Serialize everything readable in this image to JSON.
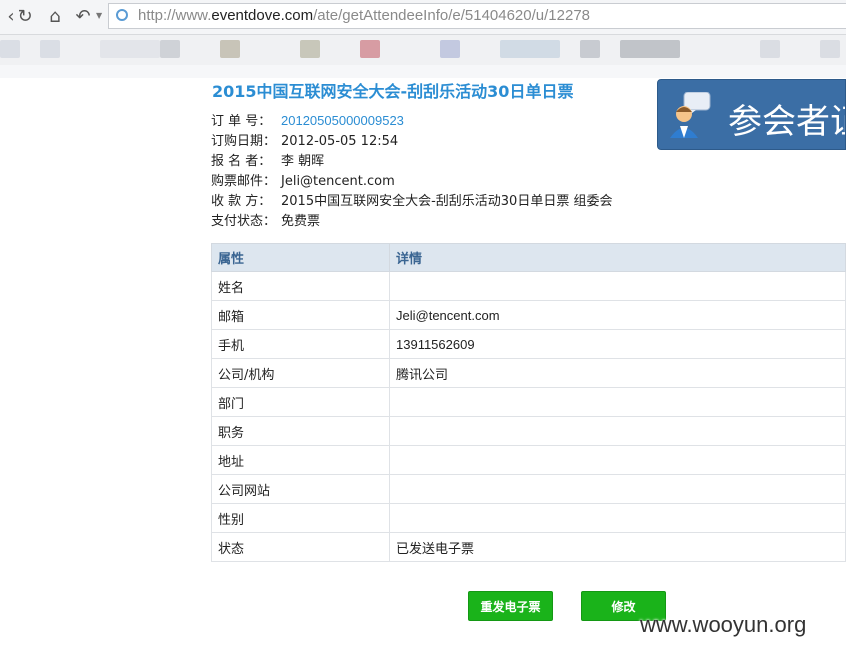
{
  "browser": {
    "url_prefix": "http://www.",
    "url_domain": "eventdove.com",
    "url_path": "/ate/getAttendeeInfo/e/51404620/u/12278"
  },
  "event": {
    "title": "2015中国互联网安全大会-刮刮乐活动30日单日票"
  },
  "banner": {
    "text": "参会者证"
  },
  "order": {
    "fields": [
      {
        "label": "订  单  号：",
        "value": "20120505000009523"
      },
      {
        "label": "订购日期：",
        "value": "2012-05-05 12:54"
      },
      {
        "label": "报  名  者：",
        "value": "李 朝晖"
      },
      {
        "label": "购票邮件：",
        "value": "Jeli@tencent.com"
      },
      {
        "label": "收  款  方：",
        "value": "2015中国互联网安全大会-刮刮乐活动30日单日票    组委会"
      },
      {
        "label": "支付状态：",
        "value": "免费票"
      }
    ]
  },
  "attendee_table": {
    "headers": [
      "属性",
      "详情"
    ],
    "rows": [
      {
        "attr": "姓名",
        "value": ""
      },
      {
        "attr": "邮箱",
        "value": "Jeli@tencent.com"
      },
      {
        "attr": "手机",
        "value": "13911562609"
      },
      {
        "attr": "公司/机构",
        "value": "腾讯公司"
      },
      {
        "attr": "部门",
        "value": ""
      },
      {
        "attr": "职务",
        "value": ""
      },
      {
        "attr": "地址",
        "value": ""
      },
      {
        "attr": "公司网站",
        "value": ""
      },
      {
        "attr": "性别",
        "value": ""
      },
      {
        "attr": "状态",
        "value": "已发送电子票"
      }
    ]
  },
  "buttons": {
    "resend": "重发电子票",
    "modify": "修改"
  },
  "watermark": "www.wooyun.org",
  "colors": {
    "title_blue": "#2b8dd3",
    "button_green": "#1ab31a",
    "table_header_bg": "#dde6ef",
    "banner_bg": "#3b6ea5"
  }
}
